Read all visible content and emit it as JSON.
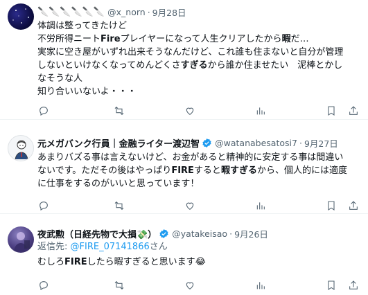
{
  "tweets": [
    {
      "name": "🔪🔪🔪🔪🔪🔪",
      "handle": "@x_norn",
      "dot": "·",
      "date": "9月28日",
      "lines": [
        [
          {
            "t": "体調は整ってきたけど",
            "b": false
          }
        ],
        [
          {
            "t": "不労所得ニート",
            "b": false
          },
          {
            "t": "Fire",
            "b": true
          },
          {
            "t": "プレイヤーになって人生クリアしたから",
            "b": false
          },
          {
            "t": "暇",
            "b": true
          },
          {
            "t": "だ…",
            "b": false
          }
        ],
        [
          {
            "t": "実家に空き屋がいずれ出来そうなんだけど、これ誰も住まないと自分が管理",
            "b": false
          }
        ],
        [
          {
            "t": "しないといけなくなってめんどくさ",
            "b": false
          },
          {
            "t": "すぎる",
            "b": true
          },
          {
            "t": "から誰か住ませたい　泥棒とかし",
            "b": false
          }
        ],
        [
          {
            "t": "なそうな人",
            "b": false
          }
        ],
        [
          {
            "t": "知り合いいないよ・・・",
            "b": false
          }
        ]
      ]
    },
    {
      "name": "元メガバンク行員｜金融ライター渡辺智",
      "handle": "@watanabesatosi7",
      "dot": "·",
      "date": "9月27日",
      "lines": [
        [
          {
            "t": "あまりバズる事は言えないけど、お金があると精神的に安定する事は間違い",
            "b": false
          }
        ],
        [
          {
            "t": "ないです。ただその後はやっぱり",
            "b": false
          },
          {
            "t": "FIRE",
            "b": true
          },
          {
            "t": "すると",
            "b": false
          },
          {
            "t": "暇すぎる",
            "b": true
          },
          {
            "t": "から、個人的には適度",
            "b": false
          }
        ],
        [
          {
            "t": "に仕事をするのがいいと思っています！",
            "b": false
          }
        ]
      ]
    },
    {
      "name": "夜武勲（日経先物で大損💸）",
      "handle": "@yatakeisao",
      "dot": "·",
      "date": "9月26日",
      "reply_label": "返信先: ",
      "reply_mention": "@FIRE_07141866",
      "reply_suffix": "さん",
      "lines": [
        [
          {
            "t": "むしろ",
            "b": false
          },
          {
            "t": "FIRE",
            "b": true
          },
          {
            "t": "したら暇すぎると思います😂",
            "b": false
          }
        ]
      ]
    }
  ],
  "icons": [
    "reply-icon",
    "retweet-icon",
    "like-icon",
    "views-icon",
    "bookmark-icon",
    "share-icon"
  ],
  "colors": {
    "text": "#0f1419",
    "secondary": "#536471",
    "link": "#1d9bf0",
    "verified": "#1d9bf0",
    "divider": "#eff3f4"
  }
}
